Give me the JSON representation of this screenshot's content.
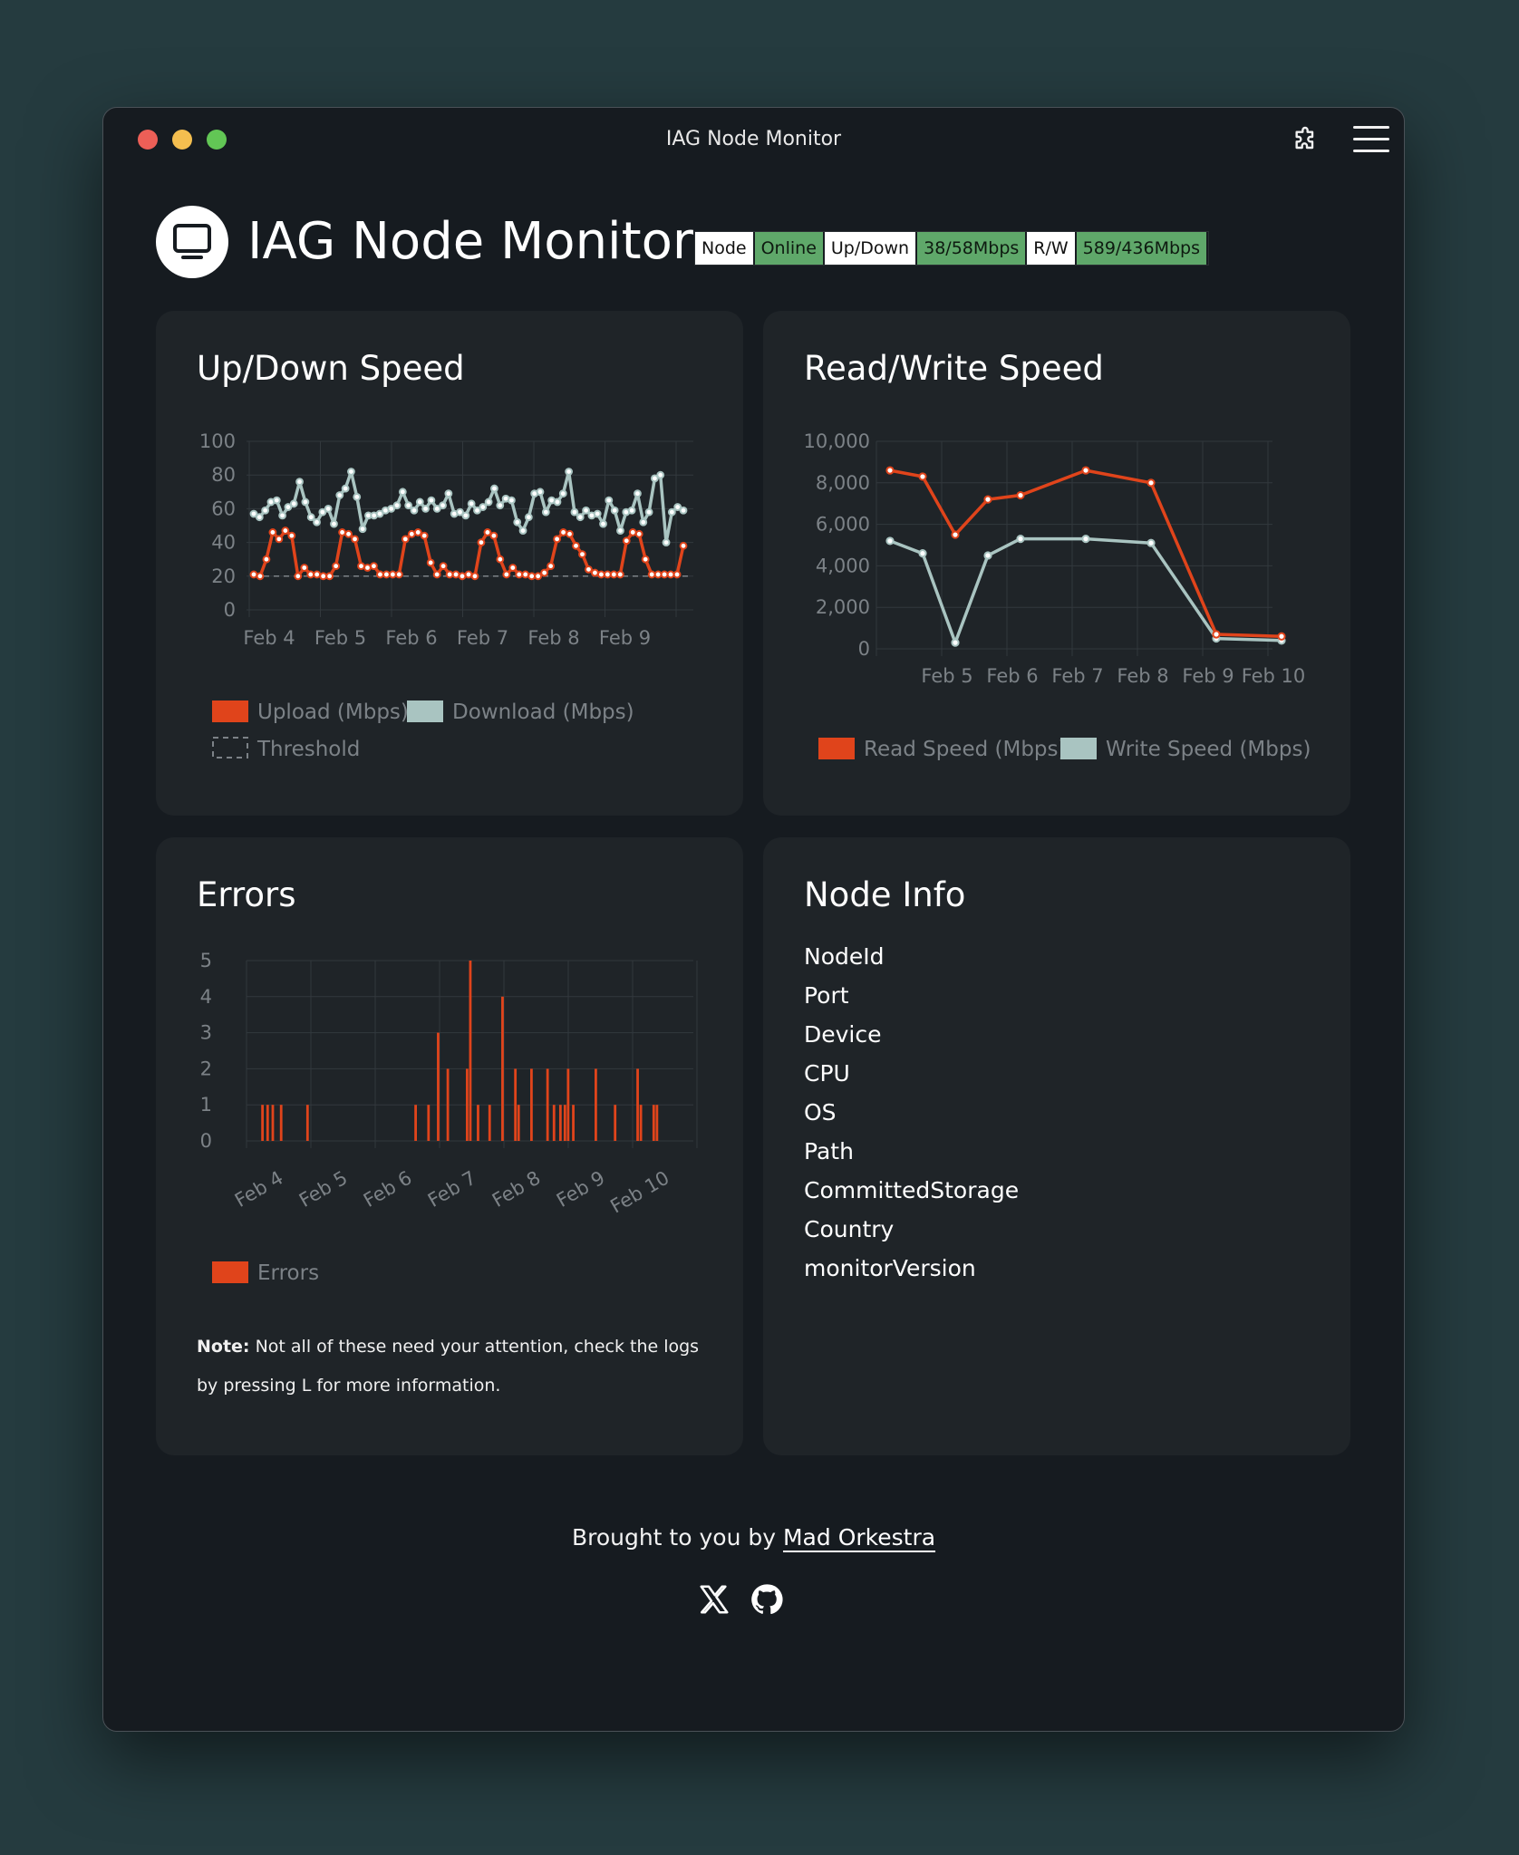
{
  "window": {
    "title": "IAG Node Monitor"
  },
  "header": {
    "title": "IAG Node Monitor",
    "badges": [
      {
        "label": "Node",
        "style": "white"
      },
      {
        "label": "Online",
        "style": "green"
      },
      {
        "label": "Up/Down",
        "style": "white"
      },
      {
        "label": "38/58Mbps",
        "style": "green"
      },
      {
        "label": "R/W",
        "style": "white"
      },
      {
        "label": "589/436Mbps",
        "style": "green"
      }
    ]
  },
  "colors": {
    "upload": "#e0441b",
    "download": "#a9c4c1",
    "accent_green": "#5fa86a",
    "bg": "#161b20",
    "card": "#1f2428"
  },
  "cards": {
    "updown": {
      "title": "Up/Down Speed"
    },
    "readwrite": {
      "title": "Read/Write Speed"
    },
    "errors": {
      "title": "Errors",
      "note_bold": "Note:",
      "note_text": " Not all of these need your attention, check the logs by pressing L for more information."
    },
    "info": {
      "title": "Node Info",
      "rows": [
        {
          "key": "NodeId",
          "value": ""
        },
        {
          "key": "Port",
          "value": ""
        },
        {
          "key": "Device",
          "value": ""
        },
        {
          "key": "CPU",
          "value": ""
        },
        {
          "key": "OS",
          "value": ""
        },
        {
          "key": "Path",
          "value": ""
        },
        {
          "key": "CommittedStorage",
          "value": ""
        },
        {
          "key": "Country",
          "value": ""
        },
        {
          "key": "monitorVersion",
          "value": ""
        }
      ]
    }
  },
  "footer": {
    "prefix": "Brought to you by ",
    "link": "Mad Orkestra"
  },
  "icons": {
    "logo": "monitor-icon",
    "extension": "puzzle-icon",
    "menu": "hamburger-menu-icon",
    "x": "x-logo-icon",
    "github": "github-icon"
  },
  "chart_data": [
    {
      "type": "line",
      "x_ticks": [
        "Feb 4",
        "Feb 5",
        "Feb 6",
        "Feb 7",
        "Feb 8",
        "Feb 9"
      ],
      "ylim": [
        0,
        100
      ],
      "y_ticks": [
        0,
        20,
        40,
        60,
        80,
        100
      ],
      "grid": true,
      "legend_position": "bottom",
      "series": [
        {
          "name": "Upload (Mbps)",
          "color": "#e0441b",
          "values": [
            21,
            20,
            30,
            46,
            42,
            47,
            44,
            20,
            25,
            21,
            21,
            20,
            20,
            26,
            46,
            45,
            42,
            26,
            25,
            26,
            21,
            21,
            21,
            21,
            42,
            45,
            46,
            44,
            28,
            21,
            26,
            21,
            21,
            20,
            21,
            20,
            40,
            46,
            44,
            30,
            21,
            25,
            21,
            21,
            20,
            20,
            22,
            26,
            42,
            46,
            45,
            38,
            33,
            24,
            22,
            21,
            21,
            21,
            21,
            41,
            46,
            45,
            30,
            21,
            21,
            21,
            21,
            21,
            38
          ]
        },
        {
          "name": "Download (Mbps)",
          "color": "#a9c4c1",
          "values": [
            57,
            55,
            59,
            64,
            65,
            56,
            61,
            63,
            76,
            64,
            55,
            52,
            58,
            60,
            51,
            68,
            72,
            82,
            67,
            48,
            56,
            56,
            57,
            59,
            60,
            62,
            70,
            62,
            59,
            64,
            60,
            65,
            60,
            62,
            69,
            57,
            58,
            56,
            63,
            59,
            61,
            64,
            72,
            62,
            66,
            65,
            52,
            47,
            55,
            69,
            70,
            58,
            65,
            64,
            69,
            82,
            58,
            55,
            59,
            56,
            57,
            51,
            65,
            59,
            47,
            58,
            59,
            69,
            52,
            58,
            78,
            80,
            40,
            58,
            61,
            59
          ]
        },
        {
          "name": "Threshold",
          "style": "dashed",
          "values": [
            20
          ]
        }
      ]
    },
    {
      "type": "line",
      "x_ticks": [
        "Feb 5",
        "Feb 6",
        "Feb 7",
        "Feb 8",
        "Feb 9",
        "Feb 10"
      ],
      "ylim": [
        0,
        10000
      ],
      "y_ticks": [
        0,
        2000,
        4000,
        6000,
        8000,
        10000
      ],
      "grid": true,
      "legend_position": "bottom",
      "series": [
        {
          "name": "Read Speed (Mbps)",
          "color": "#e0441b",
          "x": [
            0,
            0.5,
            1,
            1.5,
            2,
            3,
            4,
            5,
            6
          ],
          "values": [
            8600,
            8300,
            5500,
            7200,
            7400,
            8600,
            8000,
            700,
            600
          ]
        },
        {
          "name": "Write Speed (Mbps)",
          "color": "#a9c4c1",
          "x": [
            0,
            0.5,
            1,
            1.5,
            2,
            3,
            4,
            5,
            6
          ],
          "values": [
            5200,
            4600,
            300,
            4500,
            5300,
            5300,
            5100,
            500,
            400
          ]
        }
      ]
    },
    {
      "type": "bar",
      "x_ticks": [
        "Feb 4",
        "Feb 5",
        "Feb 6",
        "Feb 7",
        "Feb 8",
        "Feb 9",
        "Feb 10"
      ],
      "ylim": [
        0,
        5
      ],
      "y_ticks": [
        0,
        1,
        2,
        3,
        4,
        5
      ],
      "grid": true,
      "legend_position": "bottom",
      "series": [
        {
          "name": "Errors",
          "color": "#e0441b",
          "x": [
            0.22,
            0.3,
            0.38,
            0.51,
            0.92,
            2.6,
            2.8,
            2.95,
            3.1,
            3.4,
            3.45,
            3.57,
            3.75,
            3.95,
            4.15,
            4.2,
            4.4,
            4.65,
            4.75,
            4.85,
            4.92,
            4.97,
            5.05,
            5.4,
            5.7,
            6.05,
            6.1,
            6.3,
            6.35
          ],
          "values": [
            1,
            1,
            1,
            1,
            1,
            1,
            1,
            3,
            2,
            2,
            5,
            1,
            1,
            4,
            2,
            1,
            2,
            2,
            1,
            1,
            1,
            2,
            1,
            2,
            1,
            2,
            1,
            1,
            1
          ]
        }
      ]
    }
  ]
}
